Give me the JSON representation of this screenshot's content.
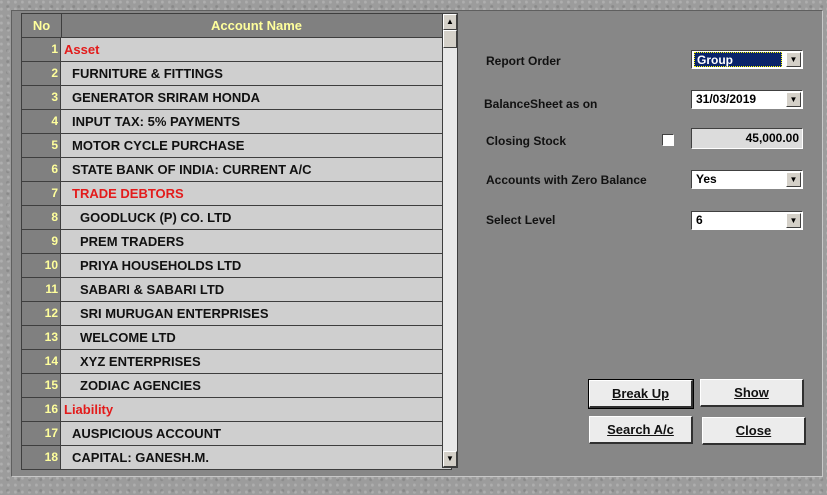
{
  "grid": {
    "col_no": "No",
    "col_name": "Account Name",
    "rows": [
      {
        "no": "1",
        "name": "Asset"
      },
      {
        "no": "2",
        "name": "FURNITURE & FITTINGS"
      },
      {
        "no": "3",
        "name": "GENERATOR SRIRAM HONDA"
      },
      {
        "no": "4",
        "name": "INPUT TAX: 5% PAYMENTS"
      },
      {
        "no": "5",
        "name": "MOTOR CYCLE PURCHASE"
      },
      {
        "no": "6",
        "name": "STATE BANK OF INDIA: CURRENT A/C"
      },
      {
        "no": "7",
        "name": "TRADE DEBTORS"
      },
      {
        "no": "8",
        "name": "GOODLUCK (P) CO. LTD"
      },
      {
        "no": "9",
        "name": "PREM TRADERS"
      },
      {
        "no": "10",
        "name": "PRIYA HOUSEHOLDS LTD"
      },
      {
        "no": "11",
        "name": "SABARI & SABARI LTD"
      },
      {
        "no": "12",
        "name": "SRI MURUGAN ENTERPRISES"
      },
      {
        "no": "13",
        "name": "WELCOME LTD"
      },
      {
        "no": "14",
        "name": "XYZ ENTERPRISES"
      },
      {
        "no": "15",
        "name": "ZODIAC AGENCIES"
      },
      {
        "no": "16",
        "name": "Liability"
      },
      {
        "no": "17",
        "name": "AUSPICIOUS ACCOUNT"
      },
      {
        "no": "18",
        "name": "CAPITAL: GANESH.M."
      }
    ]
  },
  "form": {
    "report_order_label": "Report Order",
    "report_order_value": "Group",
    "balance_sheet_label": "BalanceSheet as on",
    "balance_sheet_value": "31/03/2019",
    "closing_stock_label": "Closing Stock",
    "closing_stock_value": "45,000.00",
    "zero_balance_label": "Accounts with Zero Balance",
    "zero_balance_value": "Yes",
    "select_level_label": "Select Level",
    "select_level_value": "6"
  },
  "buttons": {
    "break_up": "Break Up",
    "show": "Show",
    "search": "Search A/c",
    "close": "Close"
  },
  "colors": {
    "group_text": "#e31b1b",
    "header_text": "#ffff9c"
  }
}
